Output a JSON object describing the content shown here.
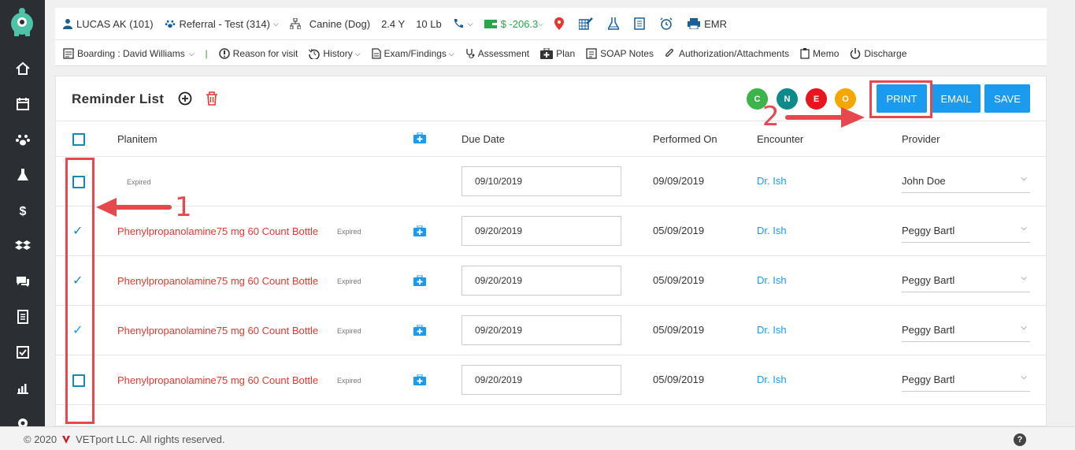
{
  "header": {
    "patient": "LUCAS AK (101)",
    "referral": "Referral - Test (314)",
    "species": "Canine (Dog)",
    "age": "2.4 Y",
    "weight": "10 Lb",
    "balance": "$ -206.3",
    "emr": "EMR"
  },
  "nav": {
    "boarding": "Boarding : David Williams",
    "separator": "|",
    "reason": "Reason for visit",
    "history": "History",
    "exam": "Exam/Findings",
    "assessment": "Assessment",
    "plan": "Plan",
    "soap": "SOAP Notes",
    "authorization": "Authorization/Attachments",
    "memo": "Memo",
    "discharge": "Discharge"
  },
  "panel": {
    "title": "Reminder List",
    "circles": [
      {
        "letter": "C",
        "color": "#3cb44b"
      },
      {
        "letter": "N",
        "color": "#0f8a8a"
      },
      {
        "letter": "E",
        "color": "#e8141e"
      },
      {
        "letter": "O",
        "color": "#f4a700"
      }
    ],
    "buttons": {
      "print": "PRINT",
      "email": "EMAIL",
      "save": "SAVE"
    }
  },
  "table": {
    "headers": {
      "planitem": "Planitem",
      "due": "Due Date",
      "performed": "Performed On",
      "encounter": "Encounter",
      "provider": "Provider"
    },
    "rows": [
      {
        "checked": false,
        "planitem": "",
        "status": "Expired",
        "due": "09/10/2019",
        "performed": "09/09/2019",
        "encounter": "Dr. Ish",
        "provider": "John Doe"
      },
      {
        "checked": true,
        "planitem": "Phenylpropanolamine75 mg 60 Count Bottle",
        "status": "Expired",
        "due": "09/20/2019",
        "performed": "05/09/2019",
        "encounter": "Dr. Ish",
        "provider": "Peggy Bartl"
      },
      {
        "checked": true,
        "planitem": "Phenylpropanolamine75 mg 60 Count Bottle",
        "status": "Expired",
        "due": "09/20/2019",
        "performed": "05/09/2019",
        "encounter": "Dr. Ish",
        "provider": "Peggy Bartl"
      },
      {
        "checked": true,
        "planitem": "Phenylpropanolamine75 mg 60 Count Bottle",
        "status": "Expired",
        "due": "09/20/2019",
        "performed": "05/09/2019",
        "encounter": "Dr. Ish",
        "provider": "Peggy Bartl"
      },
      {
        "checked": false,
        "planitem": "Phenylpropanolamine75 mg 60 Count Bottle",
        "status": "Expired",
        "due": "09/20/2019",
        "performed": "05/09/2019",
        "encounter": "Dr. Ish",
        "provider": "Peggy Bartl"
      }
    ]
  },
  "annotations": {
    "one": "1",
    "two": "2"
  },
  "footer": {
    "copyright": "© 2020",
    "company": "VETport LLC. All rights reserved.",
    "help": "?"
  },
  "colors": {
    "accent": "#1a9bef",
    "sidebar": "#2b2f33",
    "danger": "#e5382f",
    "annotation": "#e8474e"
  }
}
